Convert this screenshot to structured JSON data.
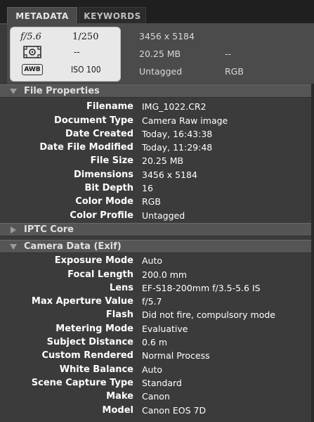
{
  "tabs": {
    "metadata": "METADATA",
    "keywords": "KEYWORDS"
  },
  "summary": {
    "aperture": "f/5.6",
    "shutter": "1/250",
    "exposure_comp": "--",
    "white_balance_badge": "AWB",
    "iso": "ISO 100",
    "dimensions": "3456 x 5184",
    "file_size": "20.25 MB",
    "extra": "--",
    "tag": "Untagged",
    "color_mode": "RGB",
    "icons": [
      "metering-icon",
      "awb-icon"
    ]
  },
  "sections": {
    "file_properties": "File Properties",
    "iptc_core": "IPTC Core",
    "camera_data": "Camera Data (Exif)"
  },
  "file_properties": [
    {
      "label": "Filename",
      "value": "IMG_1022.CR2"
    },
    {
      "label": "Document Type",
      "value": "Camera Raw image"
    },
    {
      "label": "Date Created",
      "value": "Today, 16:43:38"
    },
    {
      "label": "Date File Modified",
      "value": "Today, 11:29:48"
    },
    {
      "label": "File Size",
      "value": "20.25 MB"
    },
    {
      "label": "Dimensions",
      "value": "3456 x 5184"
    },
    {
      "label": "Bit Depth",
      "value": "16"
    },
    {
      "label": "Color Mode",
      "value": "RGB"
    },
    {
      "label": "Color Profile",
      "value": "Untagged"
    }
  ],
  "camera_data": [
    {
      "label": "Exposure Mode",
      "value": "Auto"
    },
    {
      "label": "Focal Length",
      "value": "200.0 mm"
    },
    {
      "label": "Lens",
      "value": "EF-S18-200mm f/3.5-5.6 IS"
    },
    {
      "label": "Max Aperture Value",
      "value": "f/5.7"
    },
    {
      "label": "Flash",
      "value": "Did not fire, compulsory mode"
    },
    {
      "label": "Metering Mode",
      "value": "Evaluative"
    },
    {
      "label": "Subject Distance",
      "value": "0.6 m"
    },
    {
      "label": "Custom Rendered",
      "value": "Normal Process"
    },
    {
      "label": "White Balance",
      "value": "Auto"
    },
    {
      "label": "Scene Capture Type",
      "value": "Standard"
    },
    {
      "label": "Make",
      "value": "Canon"
    },
    {
      "label": "Model",
      "value": "Canon EOS 7D"
    }
  ],
  "colors": {
    "panel_bg": "#3b3b3b",
    "header_bg": "#555555",
    "camera_box_bg": "#e8e8e8"
  }
}
